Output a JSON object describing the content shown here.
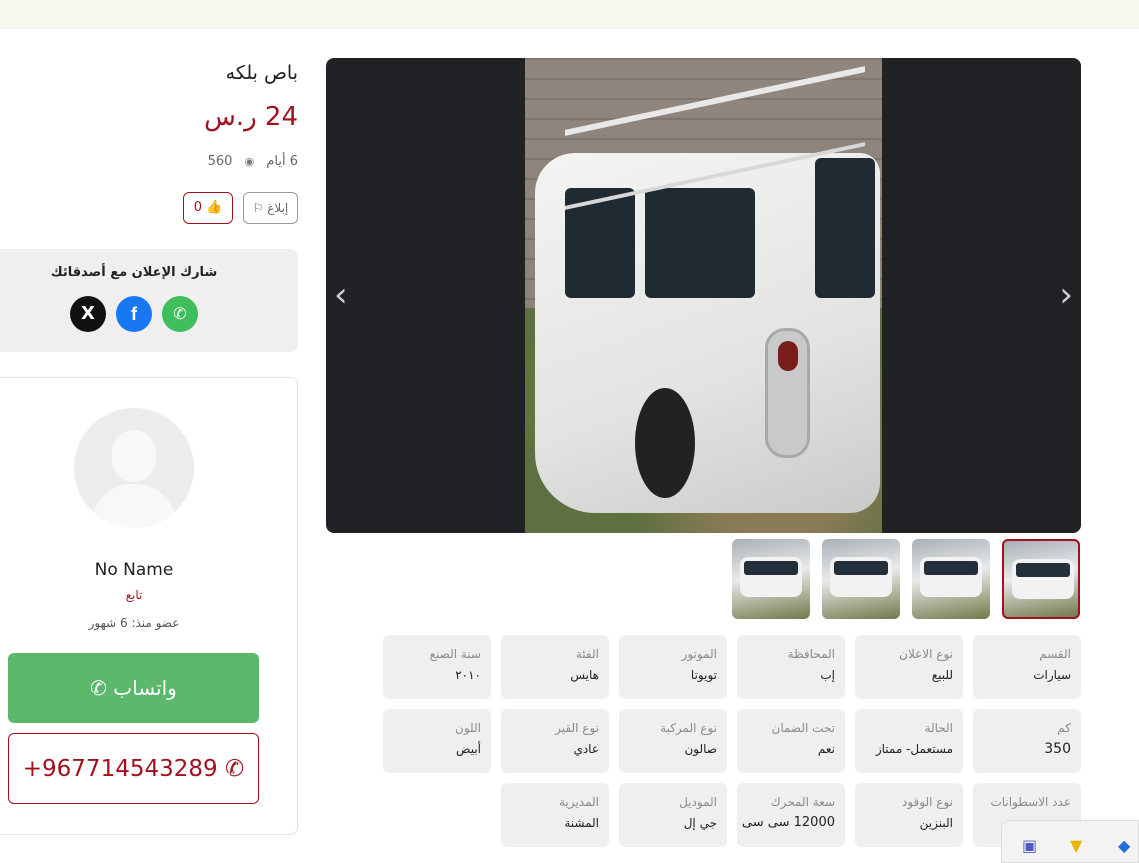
{
  "listing": {
    "title": "باص بلكه",
    "price": "24 ر.س",
    "age": "6 أيام",
    "views": "560",
    "likes_label": "0 👍",
    "report_label": "إبلاغ ⚐"
  },
  "share": {
    "title": "شارك الإعلان مع أصدقائك",
    "x_label": "X",
    "facebook_label": "f",
    "whatsapp_label": "✆"
  },
  "seller": {
    "name": "No Name",
    "role": "تابع",
    "member_since": "عضو منذ: 6 شهور",
    "whatsapp_label": "واتساب ✆",
    "phone": "+967714543289 ✆"
  },
  "gallery": {
    "prev_icon": "chevron-left-icon",
    "next_icon": "chevron-right-icon",
    "prev_glyph": "‹",
    "next_glyph": "›"
  },
  "specs": {
    "section": {
      "key": "القسم",
      "value": "سيارات"
    },
    "ad_type": {
      "key": "نوع الاعلان",
      "value": "للبيع"
    },
    "governorate": {
      "key": "المحافظة",
      "value": "إب"
    },
    "motor": {
      "key": "الموتور",
      "value": "تويوتا"
    },
    "category": {
      "key": "الفئة",
      "value": "هايس"
    },
    "year": {
      "key": "سنة الصنع",
      "value": "٢٠١٠"
    },
    "km": {
      "key": "كم",
      "value": "350"
    },
    "condition": {
      "key": "الحالة",
      "value": "مستعمل- ممتاز"
    },
    "warranty": {
      "key": "تحت الضمان",
      "value": "نعم"
    },
    "body_type": {
      "key": "نوع المركبة",
      "value": "صالون"
    },
    "gear": {
      "key": "نوع القير",
      "value": "عادي"
    },
    "color": {
      "key": "اللون",
      "value": "أبيض"
    },
    "cylinders": {
      "key": "عدد الاسطوانات",
      "value": ""
    },
    "fuel": {
      "key": "نوع الوقود",
      "value": "البنزين"
    },
    "engine": {
      "key": "سعة المحرك",
      "value": "12000 سى سى"
    },
    "model": {
      "key": "الموديل",
      "value": "جي إل"
    },
    "district": {
      "key": "المديرية",
      "value": "المشنة"
    }
  },
  "colors": {
    "accent": "#a0121e",
    "whatsapp": "#5cb96b",
    "gallery_bg": "#212226",
    "spec_bg": "#efefef"
  }
}
